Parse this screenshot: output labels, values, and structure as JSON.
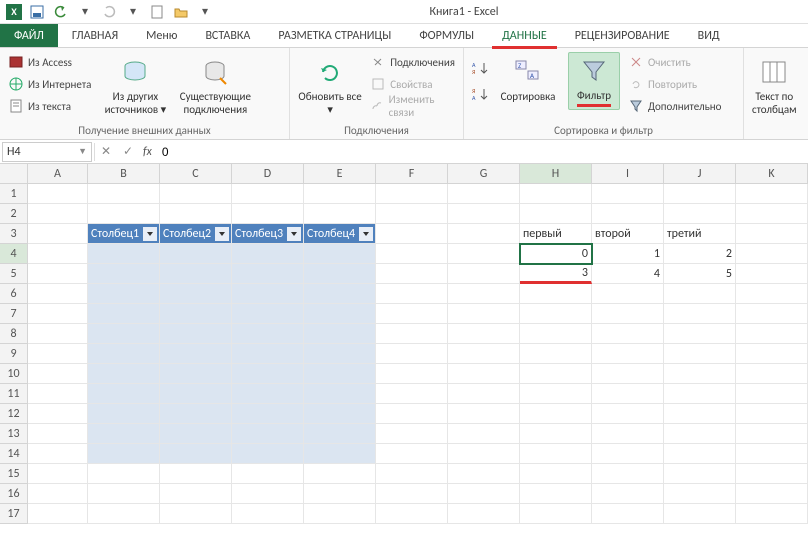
{
  "title": "Книга1 - Excel",
  "qat_icons": [
    "save",
    "undo",
    "redo",
    "new",
    "open"
  ],
  "tabs": {
    "file": "ФАЙЛ",
    "items": [
      "ГЛАВНАЯ",
      "Меню",
      "ВСТАВКА",
      "РАЗМЕТКА СТРАНИЦЫ",
      "ФОРМУЛЫ",
      "ДАННЫЕ",
      "РЕЦЕНЗИРОВАНИЕ",
      "ВИД"
    ],
    "active_index": 5
  },
  "ribbon": {
    "group_ext": {
      "access": "Из Access",
      "web": "Из Интернета",
      "text": "Из текста",
      "other": "Из других источников",
      "existing": "Существующие подключения",
      "label": "Получение внешних данных"
    },
    "group_conn": {
      "refresh": "Обновить все",
      "conns": "Подключения",
      "props": "Свойства",
      "links": "Изменить связи",
      "label": "Подключения"
    },
    "group_sort": {
      "sort": "Сортировка",
      "filter": "Фильтр",
      "clear": "Очистить",
      "reapply": "Повторить",
      "advanced": "Дополнительно",
      "label": "Сортировка и фильтр"
    },
    "group_tools": {
      "ttc": "Текст по столбцам"
    }
  },
  "namebox": "H4",
  "formula": "0",
  "columns": [
    "A",
    "B",
    "C",
    "D",
    "E",
    "F",
    "G",
    "H",
    "I",
    "J",
    "K"
  ],
  "rows": [
    "1",
    "2",
    "3",
    "4",
    "5",
    "6",
    "7",
    "8",
    "9",
    "10",
    "11",
    "12",
    "13",
    "14",
    "15",
    "16",
    "17"
  ],
  "table_headers": [
    "Столбец1",
    "Столбец2",
    "Столбец3",
    "Столбец4"
  ],
  "right_headers": [
    "первый",
    "второй",
    "третий"
  ],
  "right_data": {
    "row4": [
      "0",
      "1",
      "2"
    ],
    "row5": [
      "3",
      "4",
      "5"
    ]
  },
  "selected_cell": {
    "col": "H",
    "row": 4
  }
}
